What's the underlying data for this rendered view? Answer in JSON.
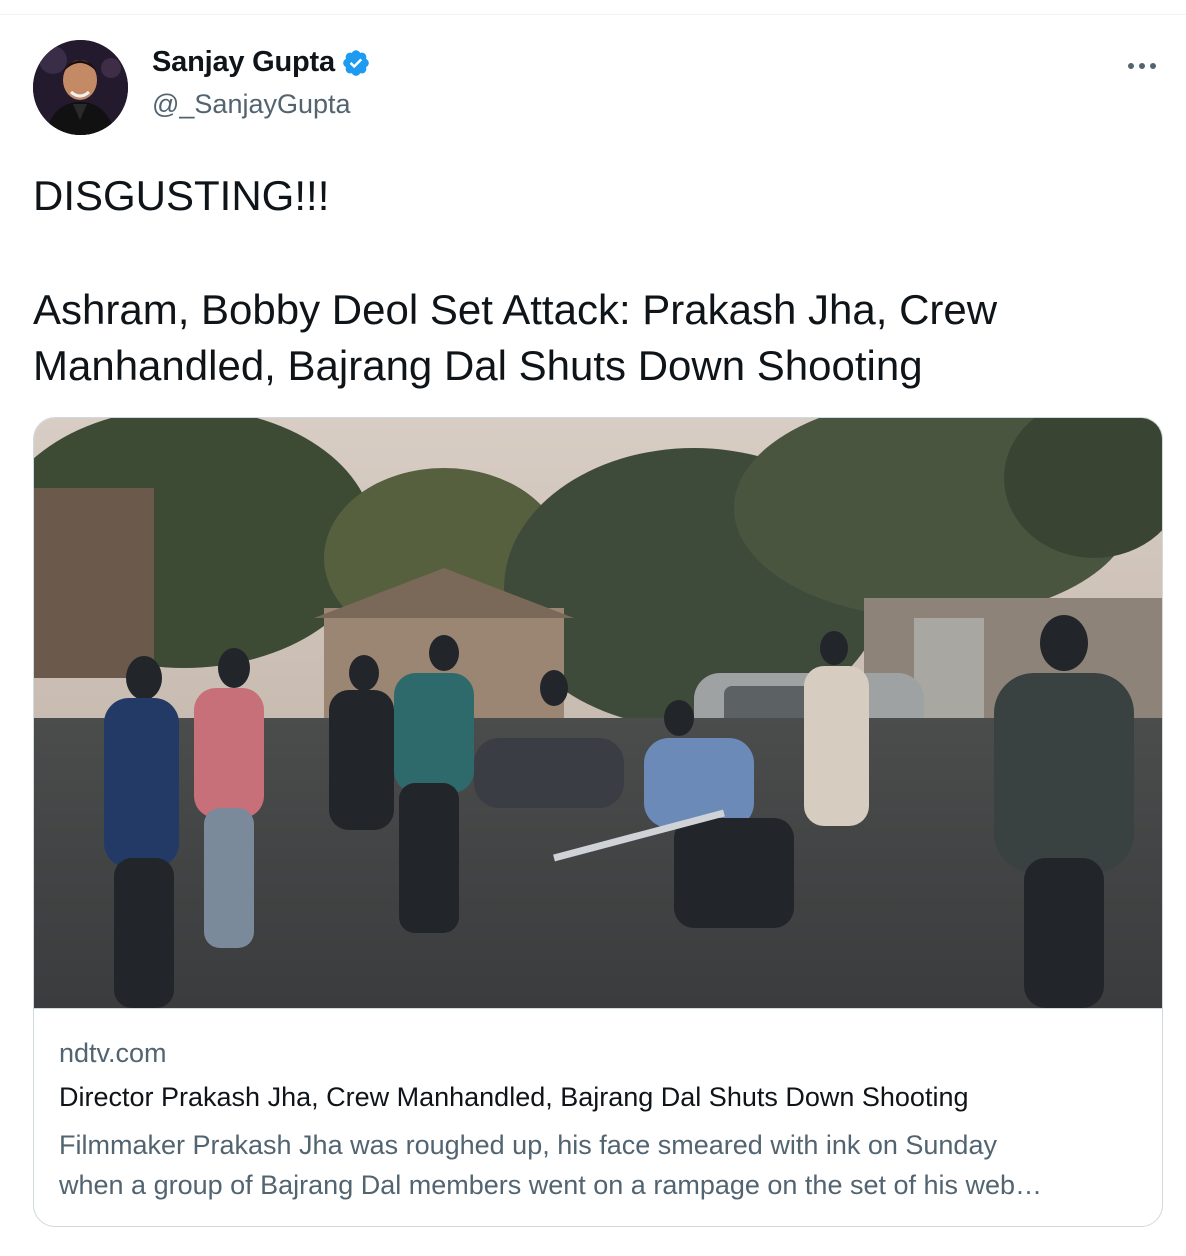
{
  "tweet": {
    "author": {
      "display_name": "Sanjay Gupta",
      "handle": "@_SanjayGupta",
      "verified": true,
      "verified_color": "#1d9bf0"
    },
    "more_icon": "more-horizontal-icon",
    "text_line1": "DISGUSTING!!!",
    "text_line2": "Ashram, Bobby Deol Set Attack: Prakash Jha, Crew Manhandled, Bajrang Dal Shuts Down Shooting"
  },
  "link_card": {
    "domain": "ndtv.com",
    "title": "Director Prakash Jha, Crew Manhandled, Bajrang Dal Shuts Down Shooting",
    "description_line1": "Filmmaker Prakash Jha was roughed up, his face smeared with ink on Sunday",
    "description_line2": "when a group of Bajrang Dal members went on a rampage on the set of his web…"
  },
  "colors": {
    "text_primary": "#0f1419",
    "text_secondary": "#536471",
    "border": "#cfd9de"
  }
}
